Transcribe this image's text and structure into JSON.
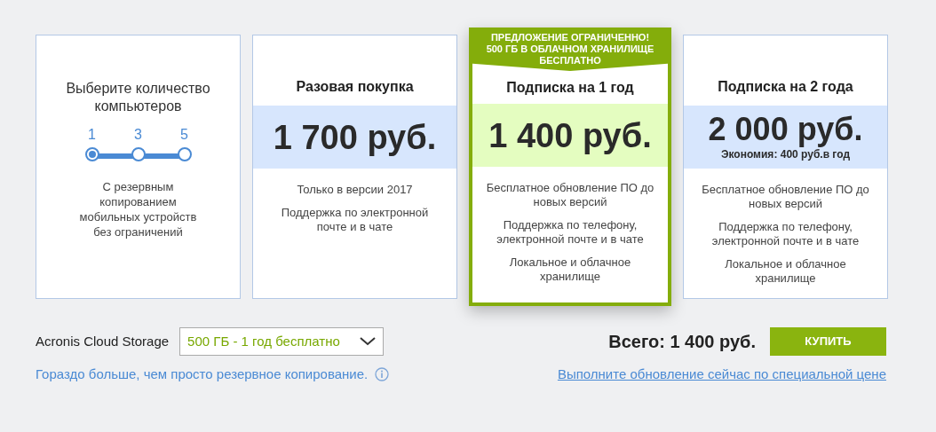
{
  "selector": {
    "title": "Выберите количество компьютеров",
    "steps": [
      {
        "label": "1",
        "selected": true
      },
      {
        "label": "3",
        "selected": false
      },
      {
        "label": "5",
        "selected": false
      }
    ],
    "description": "С резервным копированием мобильных устройств без ограничений"
  },
  "plans": [
    {
      "title": "Разовая покупка",
      "price": "1 700 руб.",
      "selected": false,
      "features": [
        "Только в версии 2017",
        "Поддержка по электронной почте и в чате"
      ]
    },
    {
      "banner": "ПРЕДЛОЖЕНИЕ ОГРАНИЧЕННО! 500 ГБ В ОБЛАЧНОМ ХРАНИЛИЩЕ БЕСПЛАТНО",
      "title": "Подписка на 1 год",
      "price": "1 400 руб.",
      "selected": true,
      "features": [
        "Бесплатное обновление ПО до новых версий",
        "Поддержка по телефону, электронной почте и в чате",
        "Локальное и облачное хранилище"
      ]
    },
    {
      "title": "Подписка на 2 года",
      "price": "2 000 руб.",
      "savings": "Экономия: 400 руб.в год",
      "selected": false,
      "features": [
        "Бесплатное обновление ПО до новых версий",
        "Поддержка по телефону, электронной почте и в чате",
        "Локальное и облачное хранилище"
      ]
    }
  ],
  "cloud_storage": {
    "label": "Acronis Cloud Storage",
    "value": "500 ГБ - 1 год бесплатно"
  },
  "total": "Всего: 1 400 руб.",
  "buy_button": "КУПИТЬ",
  "more_link": "Гораздо больше, чем просто резервное копирование.",
  "upgrade_link": "Выполните обновление сейчас по специальной цене"
}
